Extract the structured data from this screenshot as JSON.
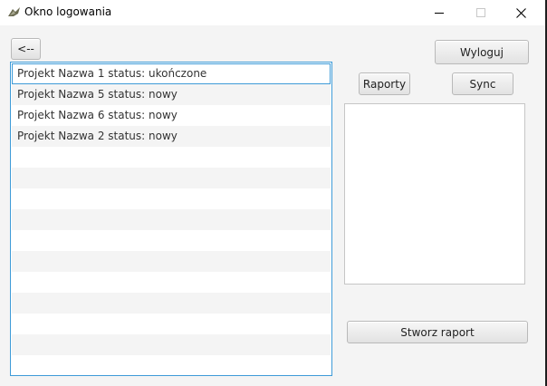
{
  "window": {
    "title": "Okno logowania"
  },
  "icons": {
    "app": "app-icon",
    "minimize": "minimize-icon",
    "maximize": "maximize-icon",
    "close": "close-icon"
  },
  "toolbar": {
    "back_label": "<--",
    "logout_label": "Wyloguj",
    "reports_label": "Raporty",
    "sync_label": "Sync",
    "create_report_label": "Stworz raport"
  },
  "projects": {
    "items": [
      {
        "label": "Projekt Nazwa 1 status: ukończone",
        "selected": true
      },
      {
        "label": "Projekt Nazwa 5 status: nowy",
        "selected": false
      },
      {
        "label": "Projekt Nazwa 6 status: nowy",
        "selected": false
      },
      {
        "label": "Projekt Nazwa 2 status: nowy",
        "selected": false
      }
    ]
  },
  "colors": {
    "accent": "#3e9bd8",
    "window_bg": "#f4f4f4",
    "row_alt": "#f4f4f4"
  }
}
